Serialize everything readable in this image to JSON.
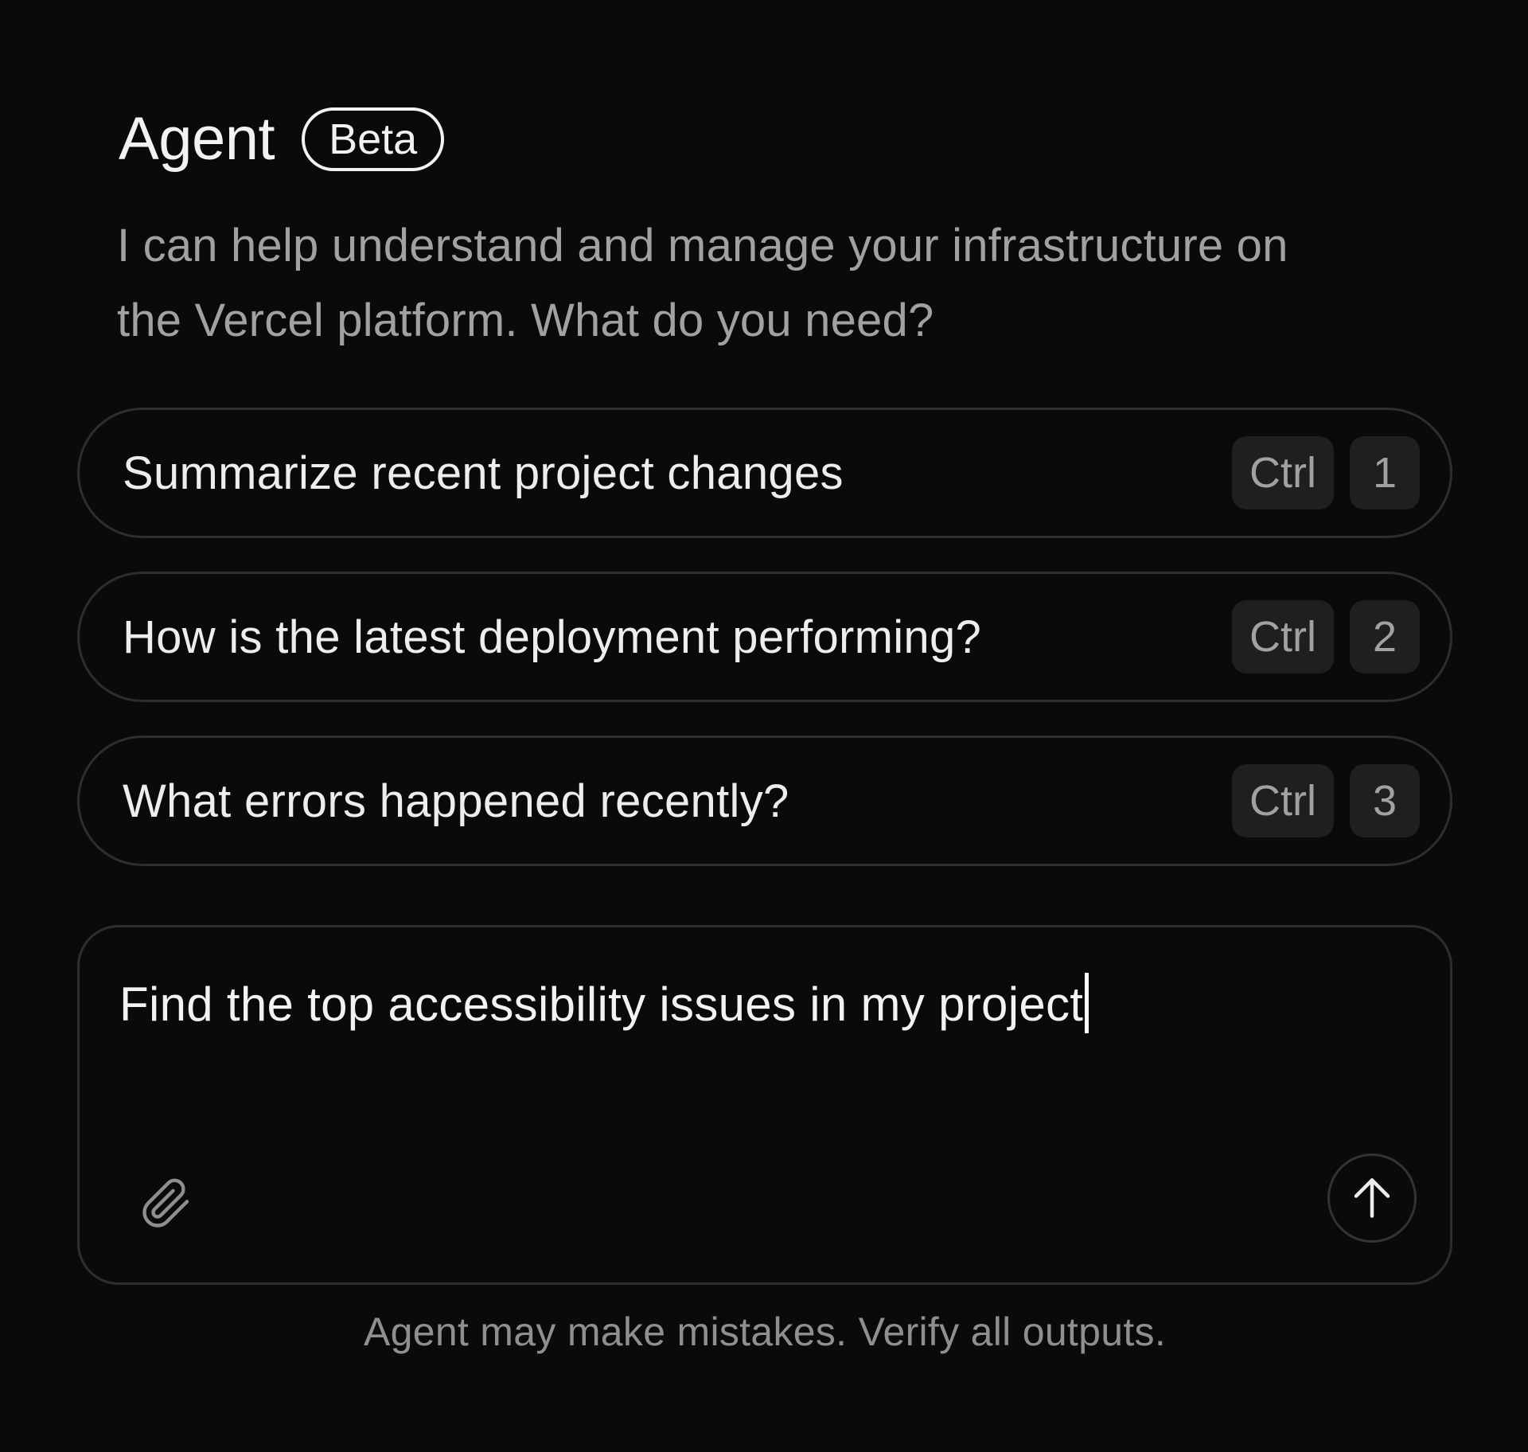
{
  "header": {
    "title": "Agent",
    "badge": "Beta"
  },
  "subtitle": {
    "line1": "I can help understand and manage your infrastructure on",
    "line2": "the Vercel platform. What do you need?"
  },
  "suggestions": [
    {
      "label": "Summarize recent project changes",
      "modifier": "Ctrl",
      "key": "1"
    },
    {
      "label": "How is the latest deployment performing?",
      "modifier": "Ctrl",
      "key": "2"
    },
    {
      "label": "What errors happened recently?",
      "modifier": "Ctrl",
      "key": "3"
    }
  ],
  "composer": {
    "value": "Find the top accessibility issues in my project",
    "attach_icon": "paperclip-icon",
    "send_icon": "arrow-up-icon"
  },
  "disclaimer": "Agent may make mistakes. Verify all outputs.",
  "colors": {
    "background": "#0a0a0a",
    "text_primary": "#ededed",
    "text_secondary": "#a1a1a1",
    "border": "#2e2e2e",
    "kbd_background": "#1f1f1f"
  }
}
